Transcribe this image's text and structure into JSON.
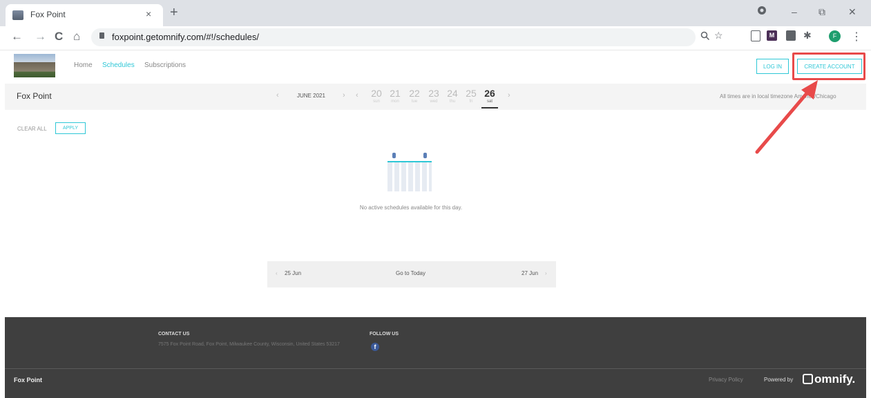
{
  "browser": {
    "tab_title": "Fox Point",
    "tab_close": "×",
    "new_tab": "+",
    "url": "foxpoint.getomnify.com/#!/schedules/",
    "nav_icons": {
      "back": "←",
      "forward": "→",
      "reload": "C",
      "home": "⌂"
    },
    "window_icons": {
      "minimize": "–",
      "restore": "⧉",
      "close": "✕"
    },
    "omni_icons": {
      "search": "🔍",
      "star": "☆"
    },
    "profile_initial": "F",
    "ext_initial": "M",
    "menu": "⋮"
  },
  "site": {
    "nav": [
      {
        "label": "Home"
      },
      {
        "label": "Schedules"
      },
      {
        "label": "Subscriptions"
      }
    ],
    "login_label": "LOG IN",
    "create_account_label": "CREATE ACCOUNT"
  },
  "schedule": {
    "location": "Fox Point",
    "month": "JUNE 2021",
    "prev": "‹",
    "next": "›",
    "days": [
      {
        "num": "20",
        "name": "sun"
      },
      {
        "num": "21",
        "name": "mon"
      },
      {
        "num": "22",
        "name": "tue"
      },
      {
        "num": "23",
        "name": "wed"
      },
      {
        "num": "24",
        "name": "thu"
      },
      {
        "num": "25",
        "name": "fri"
      },
      {
        "num": "26",
        "name": "sat"
      }
    ],
    "timezone_note": "All times are in local timezone America/Chicago",
    "clear_all": "CLEAR ALL",
    "apply": "APPLY",
    "empty_message": "No active schedules available for this day."
  },
  "pager": {
    "prev_label": "25 Jun",
    "today_label": "Go to Today",
    "next_label": "27 Jun",
    "prev_arrow": "‹",
    "next_arrow": "›"
  },
  "footer": {
    "contact_heading": "CONTACT US",
    "address": "7575 Fox Point Road, Fox Point, Milwaukee County, Wisconsin, United States 53217",
    "follow_heading": "FOLLOW US",
    "facebook_glyph": "f",
    "brand_name": "Fox Point",
    "privacy": "Privacy Policy",
    "powered_by": "Powered by",
    "omnify": "omnify."
  },
  "colors": {
    "accent": "#2ec7d6",
    "highlight": "#e84a4a",
    "footer_bg": "#3f3f3f",
    "arrow": "#e84a4a"
  }
}
